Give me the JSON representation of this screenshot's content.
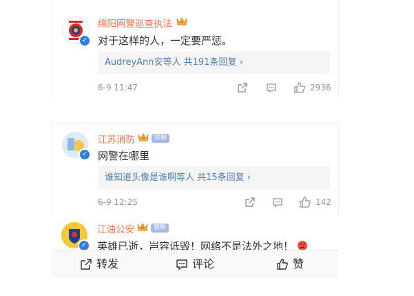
{
  "comments": [
    {
      "name": "绵阳网警巡查执法",
      "text": "对于这样的人，一定要严惩。",
      "replies": "AudreyAnn安等人 共191条回复 ›",
      "time": "6-9 11:47",
      "likes": "2936"
    },
    {
      "name": "江苏消防",
      "fan_badge": "铁粉",
      "text": "网警在哪里",
      "replies": "谁知道头像是谁啊等人 共15条回复 ›",
      "time": "6-9 12:25",
      "likes": "142"
    },
    {
      "name": "江油公安",
      "fan_badge": "铁粉",
      "text": "英雄已逝，岂容诋毁！网络不是法外之地！"
    }
  ],
  "bottom_bar": {
    "repost": "转发",
    "comment": "评论",
    "like": "赞"
  },
  "colors": {
    "name": "#eb7350",
    "link": "#507daf",
    "meta": "#939393",
    "verified": "#2f7de1"
  },
  "icons": [
    "share-icon",
    "comment-icon",
    "like-icon",
    "vip-crown-icon",
    "verified-icon",
    "angry-emoji-icon"
  ]
}
